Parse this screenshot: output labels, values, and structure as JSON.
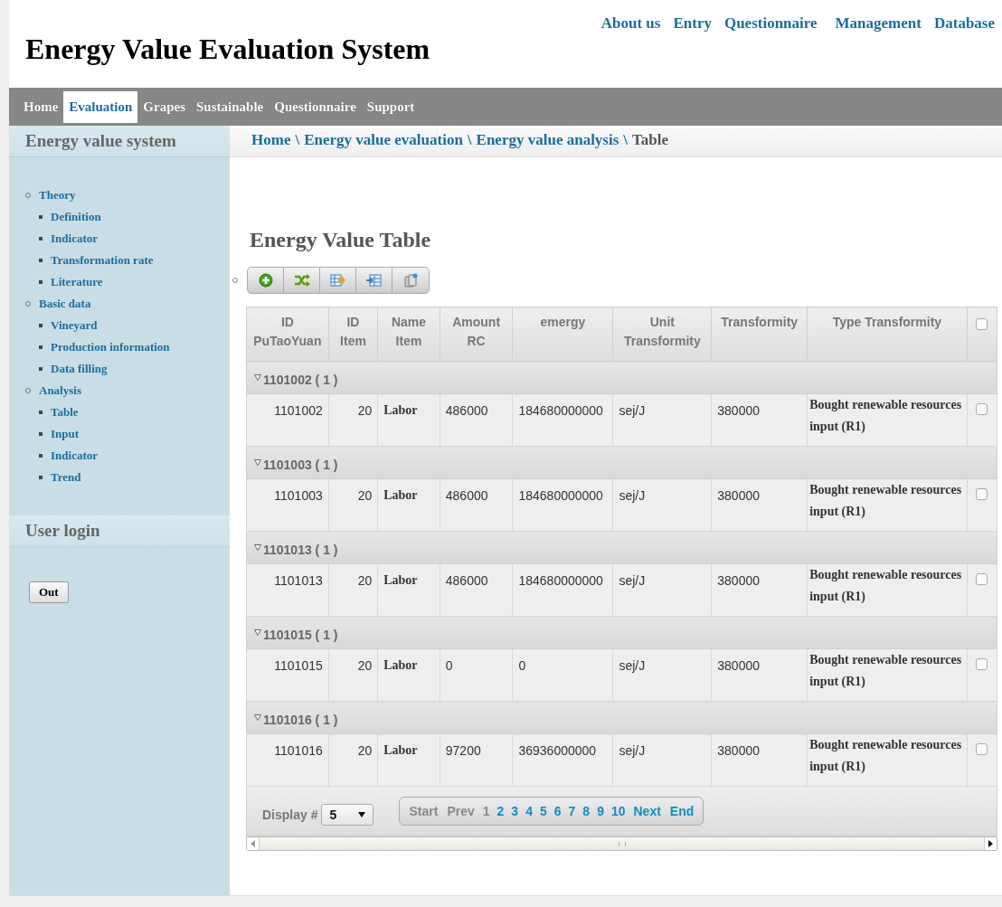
{
  "site_title": "Energy Value Evaluation System",
  "top_links": [
    "About us",
    "Entry",
    "Questionnaire",
    "Management",
    "Database"
  ],
  "nav_tabs": [
    {
      "label": "Home",
      "selected": false
    },
    {
      "label": "Evaluation",
      "selected": true
    },
    {
      "label": "Grapes",
      "selected": false
    },
    {
      "label": "Sustainable",
      "selected": false
    },
    {
      "label": "Questionnaire",
      "selected": false
    },
    {
      "label": "Support",
      "selected": false
    }
  ],
  "sidebar": {
    "title": "Energy value system",
    "items": [
      {
        "label": "Theory",
        "children": [
          {
            "label": "Definition"
          },
          {
            "label": "Indicator"
          },
          {
            "label": "Transformation rate"
          },
          {
            "label": "Literature"
          }
        ]
      },
      {
        "label": "Basic data",
        "children": [
          {
            "label": "Vineyard"
          },
          {
            "label": "Production information"
          },
          {
            "label": "Data filling"
          }
        ]
      },
      {
        "label": "Analysis",
        "children": [
          {
            "label": "Table"
          },
          {
            "label": "Input"
          },
          {
            "label": "Indicator"
          },
          {
            "label": "Trend"
          }
        ]
      }
    ],
    "login_title": "User login",
    "logout_button": "Out"
  },
  "breadcrumb": {
    "links": [
      "Home",
      "Energy value evaluation",
      "Energy value analysis"
    ],
    "separator": "\\",
    "current": "Table"
  },
  "page_title": "Energy Value Table",
  "table": {
    "columns": [
      "ID PuTaoYuan",
      "ID Item",
      "Name Item",
      "Amount RC",
      "emergy",
      "Unit Transformity",
      "Transformity",
      "Type Transformity"
    ],
    "select_all_checked": false,
    "groups": [
      {
        "label": "1101002 ( 1 )",
        "expanded": true,
        "rows": [
          {
            "cells": [
              "1101002",
              "20",
              "Labor",
              "486000",
              "184680000000",
              "sej/J",
              "380000",
              "Bought renewable resources input (R1)"
            ],
            "checked": false
          }
        ]
      },
      {
        "label": "1101003 ( 1 )",
        "expanded": true,
        "rows": [
          {
            "cells": [
              "1101003",
              "20",
              "Labor",
              "486000",
              "184680000000",
              "sej/J",
              "380000",
              "Bought renewable resources input (R1)"
            ],
            "checked": false
          }
        ]
      },
      {
        "label": "1101013 ( 1 )",
        "expanded": true,
        "rows": [
          {
            "cells": [
              "1101013",
              "20",
              "Labor",
              "486000",
              "184680000000",
              "sej/J",
              "380000",
              "Bought renewable resources input (R1)"
            ],
            "checked": false
          }
        ]
      },
      {
        "label": "1101015 ( 1 )",
        "expanded": true,
        "rows": [
          {
            "cells": [
              "1101015",
              "20",
              "Labor",
              "0",
              "0",
              "sej/J",
              "380000",
              "Bought renewable resources input (R1)"
            ],
            "checked": false
          }
        ]
      },
      {
        "label": "1101016 ( 1 )",
        "expanded": true,
        "rows": [
          {
            "cells": [
              "1101016",
              "20",
              "Labor",
              "97200",
              "36936000000",
              "sej/J",
              "380000",
              "Bought renewable resources input (R1)"
            ],
            "checked": false
          }
        ]
      }
    ]
  },
  "pager": {
    "display_label": "Display #",
    "page_size": "5",
    "buttons": [
      {
        "label": "Start",
        "disabled": true
      },
      {
        "label": "Prev",
        "disabled": true
      }
    ],
    "pages": [
      {
        "label": "1",
        "selected": true
      },
      {
        "label": "2",
        "selected": false
      },
      {
        "label": "3",
        "selected": false
      },
      {
        "label": "4",
        "selected": false
      },
      {
        "label": "5",
        "selected": false
      },
      {
        "label": "6",
        "selected": false
      },
      {
        "label": "7",
        "selected": false
      },
      {
        "label": "8",
        "selected": false
      },
      {
        "label": "9",
        "selected": false
      },
      {
        "label": "10",
        "selected": false
      }
    ],
    "next_buttons": [
      {
        "label": "Next",
        "disabled": false
      },
      {
        "label": "End",
        "disabled": false
      }
    ]
  }
}
